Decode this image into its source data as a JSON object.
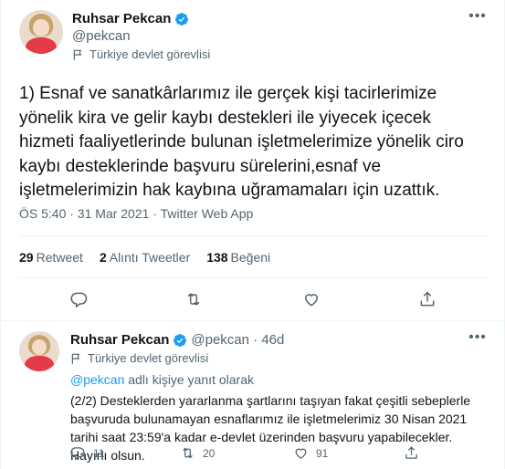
{
  "main_tweet": {
    "author_name": "Ruhsar Pekcan",
    "handle": "@pekcan",
    "label": "Türkiye devlet görevlisi",
    "text": "1) Esnaf ve sanatkârlarımız ile gerçek kişi tacirlerimize yönelik kira ve gelir kaybı destekleri ile yiyecek içecek hizmeti faaliyetlerinde bulunan işletmelerimize yönelik ciro kaybı desteklerinde başvuru sürelerini,esnaf ve işletmelerimizin hak kaybına uğramamaları için uzattık.",
    "timestamp": "ÖS 5:40 · 31 Mar 2021 · Twitter Web App",
    "stats": {
      "retweets_count": "29",
      "retweets_label": "Retweet",
      "quotes_count": "2",
      "quotes_label": "Alıntı Tweetler",
      "likes_count": "138",
      "likes_label": "Beğeni"
    }
  },
  "reply_tweet": {
    "author_name": "Ruhsar Pekcan",
    "handle_time": "@pekcan · 46d",
    "label": "Türkiye devlet görevlisi",
    "reply_to_handle": "@pekcan",
    "reply_to_suffix": " adlı kişiye yanıt olarak",
    "text": "(2/2) Desteklerden yararlanma şartlarını taşıyan fakat çeşitli sebeplerle başvuruda bulunamayan esnaflarımız ile işletmelerimiz 30 Nisan 2021 tarihi saat 23:59'a kadar e-devlet üzerinden başvuru yapabilecekler. Hayırlı olsun.",
    "reply_count": "11",
    "retweet_count": "20",
    "like_count": "91"
  },
  "colors": {
    "accent": "#1d9bf0",
    "text": "#0f1419",
    "muted": "#536471"
  },
  "icons": [
    "verified-badge-icon",
    "flag-icon",
    "more-icon",
    "reply-icon",
    "retweet-icon",
    "like-icon",
    "share-icon"
  ]
}
